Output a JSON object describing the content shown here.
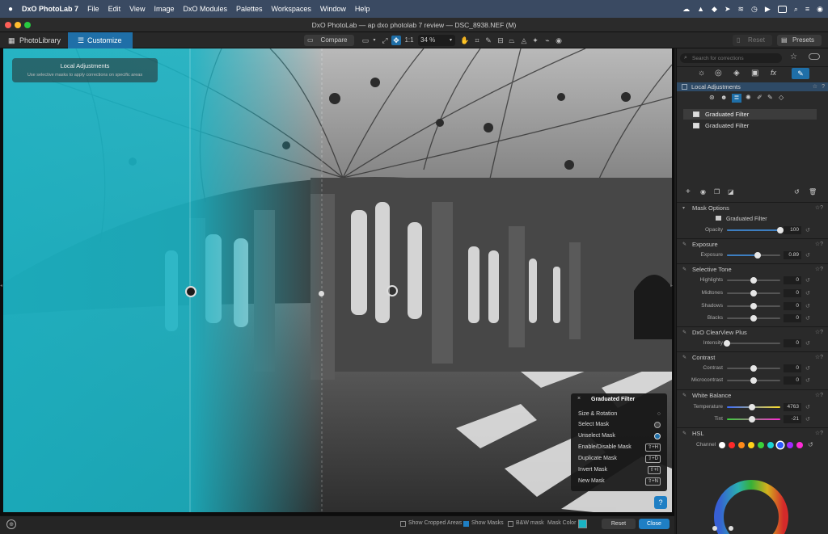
{
  "menubar": {
    "app_name": "DxO PhotoLab 7",
    "items": [
      "File",
      "Edit",
      "View",
      "Image",
      "DxO Modules",
      "Palettes",
      "Workspaces",
      "Window",
      "Help"
    ]
  },
  "window": {
    "title": "DxO PhotoLab — ap dxo photolab 7 review — DSC_8938.NEF (M)"
  },
  "toolbar": {
    "tabs": [
      {
        "label": "PhotoLibrary",
        "icon": "grid-icon"
      },
      {
        "label": "Customize",
        "icon": "sliders-icon",
        "active": true
      }
    ],
    "compare_label": "Compare",
    "one_to_one": "1:1",
    "zoom": "34 %",
    "reset_label": "Reset",
    "presets_label": "Presets"
  },
  "viewer": {
    "overlay_title": "Local Adjustments",
    "overlay_subtitle": "Use selective masks to apply corrections on specific areas",
    "help_label": "?"
  },
  "context_menu": {
    "title": "Graduated Filter",
    "items": [
      {
        "label": "Size & Rotation",
        "shortcut": ""
      },
      {
        "label": "Select Mask",
        "shortcut": ""
      },
      {
        "label": "Unselect Mask",
        "shortcut": ""
      },
      {
        "label": "Enable/Disable Mask",
        "shortcut": "⇧+H"
      },
      {
        "label": "Duplicate Mask",
        "shortcut": "⇧+D"
      },
      {
        "label": "Invert Mask",
        "shortcut": "⇧+I"
      },
      {
        "label": "New Mask",
        "shortcut": "⇧+N"
      }
    ]
  },
  "bottombar": {
    "show_cropped": "Show Cropped Areas",
    "show_masks": "Show Masks",
    "bw_mask": "B&W mask",
    "mask_color_label": "Mask Color",
    "mask_color": "#19b3c4",
    "reset_label": "Reset",
    "close_label": "Close"
  },
  "panel": {
    "search_placeholder": "Search for corrections",
    "local_adjustments": "Local Adjustments",
    "masks": [
      "Graduated Filter",
      "Graduated Filter"
    ],
    "mask_options": {
      "title": "Mask Options",
      "mask_name": "Graduated Filter",
      "opacity_label": "Opacity",
      "opacity_value": "100",
      "opacity_level": 1.0
    },
    "exposure": {
      "title": "Exposure",
      "label": "Exposure",
      "value": "0.89",
      "level": 0.57
    },
    "selective_tone": {
      "title": "Selective Tone",
      "rows": [
        {
          "label": "Highlights",
          "value": "0",
          "level": 0.5
        },
        {
          "label": "Midtones",
          "value": "0",
          "level": 0.5
        },
        {
          "label": "Shadows",
          "value": "0",
          "level": 0.5
        },
        {
          "label": "Blacks",
          "value": "0",
          "level": 0.5
        }
      ]
    },
    "clearview": {
      "title": "DxO ClearView Plus",
      "label": "Intensity",
      "value": "0",
      "level": 0.0
    },
    "contrast": {
      "title": "Contrast",
      "rows": [
        {
          "label": "Contrast",
          "value": "0",
          "level": 0.5
        },
        {
          "label": "Microcontrast",
          "value": "0",
          "level": 0.5
        }
      ]
    },
    "white_balance": {
      "title": "White Balance",
      "rows": [
        {
          "label": "Temperature",
          "value": "4763",
          "level": 0.47
        },
        {
          "label": "Tint",
          "value": "-21",
          "level": 0.47
        }
      ]
    },
    "hsl": {
      "title": "HSL",
      "channel_label": "Channel",
      "channel_colors": [
        "#ffffff",
        "#ff2a2a",
        "#ff8a1a",
        "#ffd21a",
        "#3ad13a",
        "#1ad4d4",
        "#2a5aff",
        "#a02aff",
        "#ff2ad6"
      ],
      "selected_channel": 6
    }
  }
}
